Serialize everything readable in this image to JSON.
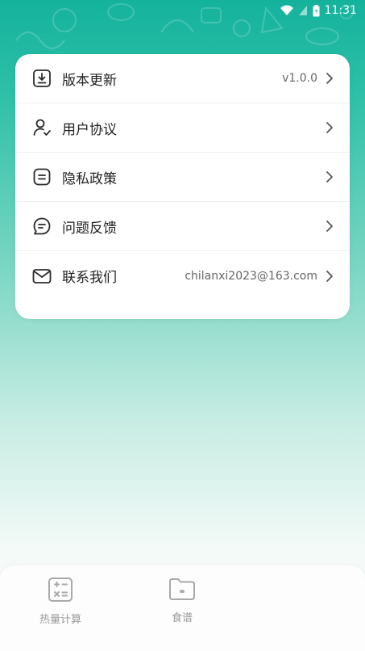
{
  "status_bar": {
    "time": "11:31"
  },
  "settings": {
    "items": [
      {
        "label": "版本更新",
        "value": "v1.0.0",
        "icon": "download-icon"
      },
      {
        "label": "用户协议",
        "value": "",
        "icon": "user-check-icon"
      },
      {
        "label": "隐私政策",
        "value": "",
        "icon": "document-icon"
      },
      {
        "label": "问题反馈",
        "value": "",
        "icon": "chat-icon"
      },
      {
        "label": "联系我们",
        "value": "chilanxi2023@163.com",
        "icon": "mail-icon"
      }
    ]
  },
  "tabbar": {
    "tabs": [
      {
        "label": "热量计算",
        "icon": "calculator-icon"
      },
      {
        "label": "食谱",
        "icon": "folder-icon"
      }
    ]
  },
  "colors": {
    "accent": "#14b29c",
    "icon_stroke": "#2b2b2b",
    "tab_inactive": "#9a9a9a"
  }
}
